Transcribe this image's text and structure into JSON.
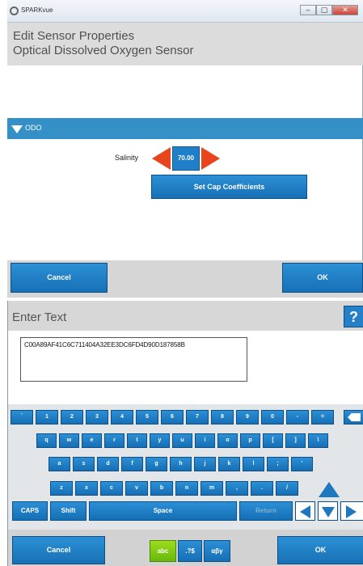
{
  "window": {
    "app_title": "SPARKvue",
    "header_line1": "Edit Sensor Properties",
    "header_line2": "Optical Dissolved Oxygen Sensor"
  },
  "section": {
    "label": "ODO"
  },
  "salinity": {
    "label": "Salinity",
    "value": "70.00"
  },
  "cap_button": "Set Cap Coefficients",
  "bottom": {
    "cancel": "Cancel",
    "ok": "OK"
  },
  "enter_text": {
    "title": "Enter Text",
    "help": "?",
    "value": "C00A89AF41C6C711404A32EE3DC6FD4D90D187858B"
  },
  "keyboard": {
    "row1": [
      "`",
      "1",
      "2",
      "3",
      "4",
      "5",
      "6",
      "7",
      "8",
      "9",
      "0",
      "-",
      "="
    ],
    "row2": [
      "q",
      "w",
      "e",
      "r",
      "t",
      "y",
      "u",
      "i",
      "o",
      "p",
      "[",
      "]",
      "\\"
    ],
    "row3": [
      "a",
      "s",
      "d",
      "f",
      "g",
      "h",
      "j",
      "k",
      "l",
      ";",
      "'"
    ],
    "row4": [
      "z",
      "x",
      "c",
      "v",
      "b",
      "n",
      "m",
      ",",
      ".",
      "/"
    ],
    "caps": "CAPS",
    "shift": "Shift",
    "space": "Space",
    "return": "Return"
  },
  "modes": {
    "abc": "abc",
    "symbols": ".?$",
    "greek": "αβγ"
  },
  "colors": {
    "accent_blue": "#1f7fc8",
    "arrow_red": "#e8451c",
    "mode_green": "#7cc514"
  }
}
